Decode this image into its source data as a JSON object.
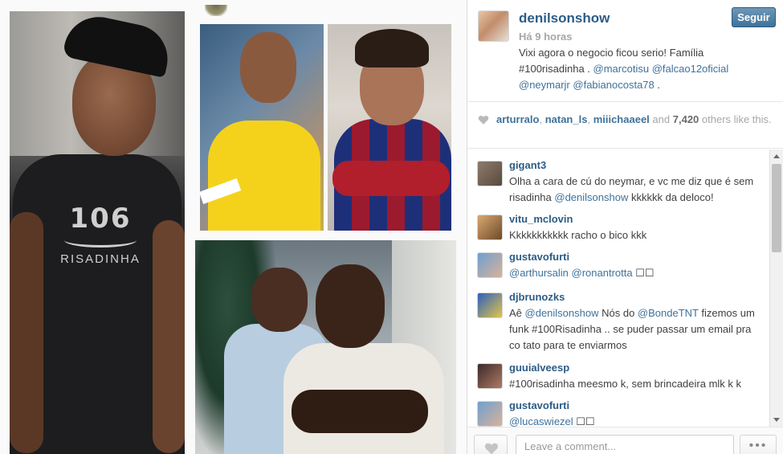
{
  "post": {
    "username": "denilsonshow",
    "follow_label": "Seguir",
    "timestamp": "Há 9 horas",
    "caption_text": "Vixi agora o negocio ficou serio! Família #100risadinha .",
    "caption_mentions": [
      "@marcotisu",
      "@falcao12oficial",
      "@neymarjr",
      "@fabianocosta78"
    ],
    "caption_end": " ."
  },
  "photo": {
    "shirt_number": "106",
    "shirt_word": "RISADINHA"
  },
  "likes": {
    "users": [
      "arturralo",
      "natan_ls",
      "miiichaaeel"
    ],
    "and_label": "and",
    "count": "7,420",
    "suffix": "others like this."
  },
  "comments": [
    {
      "user": "gigant3",
      "text_before": "Olha a cara de cú do neymar, e vc me diz que é sem risadinha ",
      "mention": "@denilsonshow",
      "text_after": " kkkkkk da deloco!"
    },
    {
      "user": "vitu_mclovin",
      "text_before": "Kkkkkkkkkkk racho o bico kkk",
      "mention": "",
      "text_after": ""
    },
    {
      "user": "gustavofurti",
      "text_before": "",
      "mention": "@arthursalin @ronantrotta",
      "text_after": " ☐☐"
    },
    {
      "user": "djbrunozks",
      "text_before": "Aê ",
      "mention": "@denilsonshow",
      "text_mid": " Nós do ",
      "mention2": "@BondeTNT",
      "text_after": " fizemos um funk #100Risadinha .. se puder passar um email pra co tato para te enviarmos"
    },
    {
      "user": "guuialveesp",
      "text_before": "#100risadinha meesmo k, sem brincadeira mlk k k",
      "mention": "",
      "text_after": ""
    },
    {
      "user": "gustavofurti",
      "text_before": "",
      "mention": "@lucaswiezel",
      "text_after": " ☐☐"
    }
  ],
  "footer": {
    "comment_placeholder": "Leave a comment...",
    "more_label": "•••"
  },
  "colors": {
    "link": "#3f729b",
    "username": "#2d5c86",
    "muted": "#a5a7aa",
    "follow_button": "#3f729b"
  },
  "icons": [
    "heart-icon",
    "scroll-up-arrow-icon",
    "scroll-down-arrow-icon"
  ]
}
